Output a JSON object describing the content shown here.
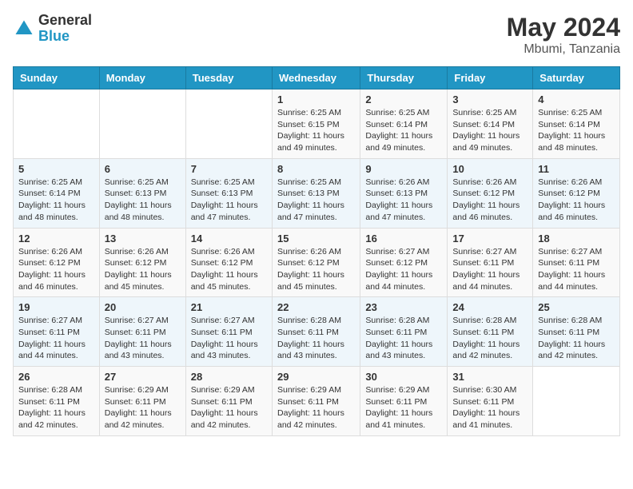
{
  "header": {
    "logo_general": "General",
    "logo_blue": "Blue",
    "month_year": "May 2024",
    "location": "Mbumi, Tanzania"
  },
  "weekdays": [
    "Sunday",
    "Monday",
    "Tuesday",
    "Wednesday",
    "Thursday",
    "Friday",
    "Saturday"
  ],
  "weeks": [
    [
      {
        "day": "",
        "sunrise": "",
        "sunset": "",
        "daylight": ""
      },
      {
        "day": "",
        "sunrise": "",
        "sunset": "",
        "daylight": ""
      },
      {
        "day": "",
        "sunrise": "",
        "sunset": "",
        "daylight": ""
      },
      {
        "day": "1",
        "sunrise": "Sunrise: 6:25 AM",
        "sunset": "Sunset: 6:15 PM",
        "daylight": "Daylight: 11 hours and 49 minutes."
      },
      {
        "day": "2",
        "sunrise": "Sunrise: 6:25 AM",
        "sunset": "Sunset: 6:14 PM",
        "daylight": "Daylight: 11 hours and 49 minutes."
      },
      {
        "day": "3",
        "sunrise": "Sunrise: 6:25 AM",
        "sunset": "Sunset: 6:14 PM",
        "daylight": "Daylight: 11 hours and 49 minutes."
      },
      {
        "day": "4",
        "sunrise": "Sunrise: 6:25 AM",
        "sunset": "Sunset: 6:14 PM",
        "daylight": "Daylight: 11 hours and 48 minutes."
      }
    ],
    [
      {
        "day": "5",
        "sunrise": "Sunrise: 6:25 AM",
        "sunset": "Sunset: 6:14 PM",
        "daylight": "Daylight: 11 hours and 48 minutes."
      },
      {
        "day": "6",
        "sunrise": "Sunrise: 6:25 AM",
        "sunset": "Sunset: 6:13 PM",
        "daylight": "Daylight: 11 hours and 48 minutes."
      },
      {
        "day": "7",
        "sunrise": "Sunrise: 6:25 AM",
        "sunset": "Sunset: 6:13 PM",
        "daylight": "Daylight: 11 hours and 47 minutes."
      },
      {
        "day": "8",
        "sunrise": "Sunrise: 6:25 AM",
        "sunset": "Sunset: 6:13 PM",
        "daylight": "Daylight: 11 hours and 47 minutes."
      },
      {
        "day": "9",
        "sunrise": "Sunrise: 6:26 AM",
        "sunset": "Sunset: 6:13 PM",
        "daylight": "Daylight: 11 hours and 47 minutes."
      },
      {
        "day": "10",
        "sunrise": "Sunrise: 6:26 AM",
        "sunset": "Sunset: 6:12 PM",
        "daylight": "Daylight: 11 hours and 46 minutes."
      },
      {
        "day": "11",
        "sunrise": "Sunrise: 6:26 AM",
        "sunset": "Sunset: 6:12 PM",
        "daylight": "Daylight: 11 hours and 46 minutes."
      }
    ],
    [
      {
        "day": "12",
        "sunrise": "Sunrise: 6:26 AM",
        "sunset": "Sunset: 6:12 PM",
        "daylight": "Daylight: 11 hours and 46 minutes."
      },
      {
        "day": "13",
        "sunrise": "Sunrise: 6:26 AM",
        "sunset": "Sunset: 6:12 PM",
        "daylight": "Daylight: 11 hours and 45 minutes."
      },
      {
        "day": "14",
        "sunrise": "Sunrise: 6:26 AM",
        "sunset": "Sunset: 6:12 PM",
        "daylight": "Daylight: 11 hours and 45 minutes."
      },
      {
        "day": "15",
        "sunrise": "Sunrise: 6:26 AM",
        "sunset": "Sunset: 6:12 PM",
        "daylight": "Daylight: 11 hours and 45 minutes."
      },
      {
        "day": "16",
        "sunrise": "Sunrise: 6:27 AM",
        "sunset": "Sunset: 6:12 PM",
        "daylight": "Daylight: 11 hours and 44 minutes."
      },
      {
        "day": "17",
        "sunrise": "Sunrise: 6:27 AM",
        "sunset": "Sunset: 6:11 PM",
        "daylight": "Daylight: 11 hours and 44 minutes."
      },
      {
        "day": "18",
        "sunrise": "Sunrise: 6:27 AM",
        "sunset": "Sunset: 6:11 PM",
        "daylight": "Daylight: 11 hours and 44 minutes."
      }
    ],
    [
      {
        "day": "19",
        "sunrise": "Sunrise: 6:27 AM",
        "sunset": "Sunset: 6:11 PM",
        "daylight": "Daylight: 11 hours and 44 minutes."
      },
      {
        "day": "20",
        "sunrise": "Sunrise: 6:27 AM",
        "sunset": "Sunset: 6:11 PM",
        "daylight": "Daylight: 11 hours and 43 minutes."
      },
      {
        "day": "21",
        "sunrise": "Sunrise: 6:27 AM",
        "sunset": "Sunset: 6:11 PM",
        "daylight": "Daylight: 11 hours and 43 minutes."
      },
      {
        "day": "22",
        "sunrise": "Sunrise: 6:28 AM",
        "sunset": "Sunset: 6:11 PM",
        "daylight": "Daylight: 11 hours and 43 minutes."
      },
      {
        "day": "23",
        "sunrise": "Sunrise: 6:28 AM",
        "sunset": "Sunset: 6:11 PM",
        "daylight": "Daylight: 11 hours and 43 minutes."
      },
      {
        "day": "24",
        "sunrise": "Sunrise: 6:28 AM",
        "sunset": "Sunset: 6:11 PM",
        "daylight": "Daylight: 11 hours and 42 minutes."
      },
      {
        "day": "25",
        "sunrise": "Sunrise: 6:28 AM",
        "sunset": "Sunset: 6:11 PM",
        "daylight": "Daylight: 11 hours and 42 minutes."
      }
    ],
    [
      {
        "day": "26",
        "sunrise": "Sunrise: 6:28 AM",
        "sunset": "Sunset: 6:11 PM",
        "daylight": "Daylight: 11 hours and 42 minutes."
      },
      {
        "day": "27",
        "sunrise": "Sunrise: 6:29 AM",
        "sunset": "Sunset: 6:11 PM",
        "daylight": "Daylight: 11 hours and 42 minutes."
      },
      {
        "day": "28",
        "sunrise": "Sunrise: 6:29 AM",
        "sunset": "Sunset: 6:11 PM",
        "daylight": "Daylight: 11 hours and 42 minutes."
      },
      {
        "day": "29",
        "sunrise": "Sunrise: 6:29 AM",
        "sunset": "Sunset: 6:11 PM",
        "daylight": "Daylight: 11 hours and 42 minutes."
      },
      {
        "day": "30",
        "sunrise": "Sunrise: 6:29 AM",
        "sunset": "Sunset: 6:11 PM",
        "daylight": "Daylight: 11 hours and 41 minutes."
      },
      {
        "day": "31",
        "sunrise": "Sunrise: 6:30 AM",
        "sunset": "Sunset: 6:11 PM",
        "daylight": "Daylight: 11 hours and 41 minutes."
      },
      {
        "day": "",
        "sunrise": "",
        "sunset": "",
        "daylight": ""
      }
    ]
  ]
}
